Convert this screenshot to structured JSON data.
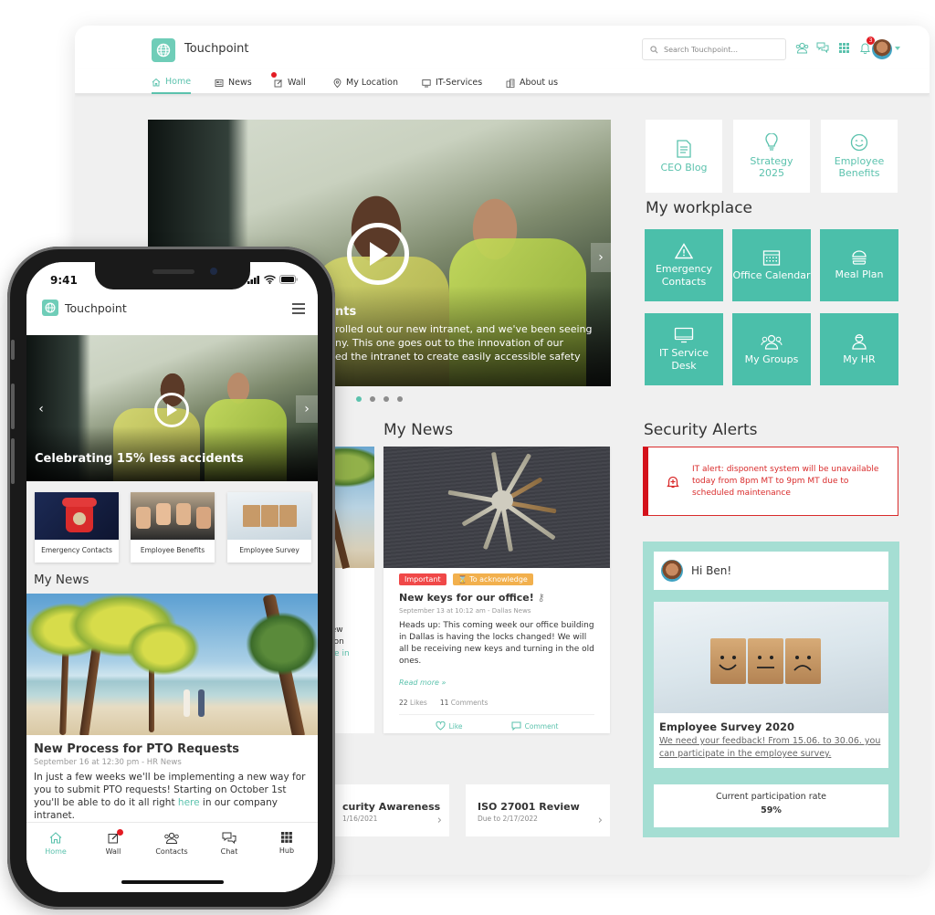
{
  "desktop": {
    "brand": "Touchpoint",
    "search": {
      "placeholder": "Search Touchpoint..."
    },
    "notification_count": "3",
    "nav": [
      {
        "label": "Home",
        "icon": "home-icon",
        "active": true
      },
      {
        "label": "News",
        "icon": "newspaper-icon"
      },
      {
        "label": "Wall",
        "icon": "edit-icon",
        "has_dot": true
      },
      {
        "label": "My Location",
        "icon": "map-pin-icon"
      },
      {
        "label": "IT-Services",
        "icon": "monitor-icon"
      },
      {
        "label": "About us",
        "icon": "building-icon"
      }
    ],
    "hero": {
      "title_partial": "nts",
      "text_lines": [
        "rolled out our new intranet, and we've been seeing",
        "ny. This one goes out to the innovation of our",
        "ed the intranet to create easily accessible safety"
      ],
      "slides_total": 4,
      "active_slide": 1
    },
    "quick_links": [
      {
        "label": "CEO Blog",
        "icon": "document-icon"
      },
      {
        "label": "Strategy 2025",
        "icon": "lightbulb-icon"
      },
      {
        "label": "Employee Benefits",
        "icon": "smile-icon"
      }
    ],
    "workplace": {
      "title": "My workplace",
      "tiles": [
        {
          "label": "Emergency Contacts",
          "icon": "warning-icon"
        },
        {
          "label": "Office Calendar",
          "icon": "calendar-icon"
        },
        {
          "label": "Meal Plan",
          "icon": "burger-icon"
        },
        {
          "label": "IT Service Desk",
          "icon": "monitor-icon"
        },
        {
          "label": "My Groups",
          "icon": "group-icon"
        },
        {
          "label": "My HR",
          "icon": "person-icon"
        }
      ]
    },
    "news": {
      "title": "My News",
      "left_partial_text": [
        "new",
        "g on",
        "ere in"
      ],
      "card": {
        "tags": [
          "Important",
          "To acknowledge"
        ],
        "title": "New keys for our office!",
        "meta": "September 13 at 10:12 am - Dallas News",
        "body": "Heads up: This coming week our office building in Dallas is having the locks changed! We will all be receiving new keys and turning in the old ones.",
        "read_more": "Read more »",
        "likes_count": "22",
        "likes_label": "Likes",
        "comments_count": "11",
        "comments_label": "Comments",
        "like_action": "Like",
        "comment_action": "Comment"
      }
    },
    "security": {
      "title": "Security Alerts",
      "alert": "IT alert: disponent system will be unavailable today from 8pm MT to 9pm MT due to scheduled maintenance"
    },
    "welcome": {
      "greeting": "Hi Ben!",
      "survey_title": "Employee Survey 2020",
      "survey_desc": "We need your feedback! From 15.06. to 30.06. you can participate in the employee survey.",
      "rate_label": "Current participation rate",
      "rate_value": "59%"
    },
    "tasks": [
      {
        "title": "curity Awareness",
        "due": "1/16/2021"
      },
      {
        "title": "ISO 27001 Review",
        "due": "Due to 2/17/2022"
      }
    ]
  },
  "phone": {
    "time": "9:41",
    "brand": "Touchpoint",
    "hero_title": "Celebrating 15% less accidents",
    "quick_links": [
      {
        "label": "Emergency Contacts"
      },
      {
        "label": "Employee Benefits"
      },
      {
        "label": "Employee Survey"
      }
    ],
    "news_section": "My News",
    "news": {
      "title": "New Process for PTO Requests",
      "meta": "September 16 at 12:30 pm - HR News",
      "body_before_link": "In just a few weeks we'll be implementing a new way for you to submit PTO requests! Starting on October 1st you'll be able to do it all right ",
      "link": "here",
      "body_after_link": " in our company intranet."
    },
    "tabs": [
      {
        "label": "Home",
        "icon": "home-icon",
        "active": true
      },
      {
        "label": "Wall",
        "icon": "edit-icon",
        "has_dot": true
      },
      {
        "label": "Contacts",
        "icon": "contacts-icon"
      },
      {
        "label": "Chat",
        "icon": "chat-icon"
      },
      {
        "label": "Hub",
        "icon": "grid-icon"
      }
    ]
  },
  "colors": {
    "accent": "#5bc2ad",
    "tile": "#4bbfaa",
    "alert_red": "#d4111b",
    "widget_bg": "#a5ded3"
  }
}
